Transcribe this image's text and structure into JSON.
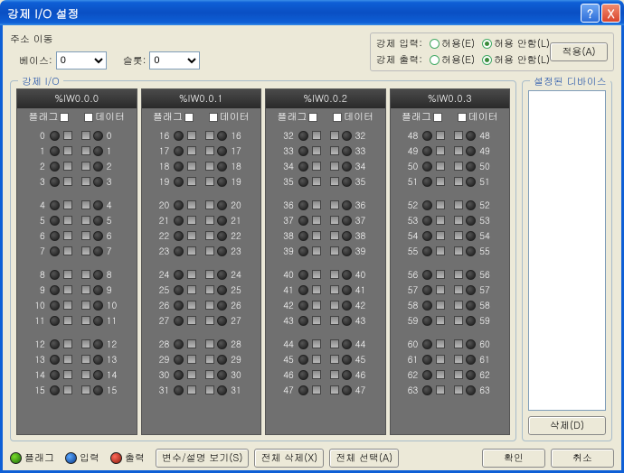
{
  "window": {
    "title": "강제 I/O 설정"
  },
  "addr": {
    "label": "주소 이동",
    "base_label": "베이스:",
    "base_value": "0",
    "slot_label": "슬롯:",
    "slot_value": "0"
  },
  "force": {
    "input_label": "강제 입력:",
    "output_label": "강제 출력:",
    "allow": "허용(E)",
    "disallow": "허용 안함(L)",
    "input_selected": "disallow",
    "output_selected": "disallow",
    "apply": "적용(A)"
  },
  "io_fieldset": "강제 I/O",
  "dev_fieldset": "설정된 디바이스",
  "columns": [
    {
      "header": "%IW0.0.0",
      "flag": "플래그",
      "data": "데이터",
      "start": 0
    },
    {
      "header": "%IW0.0.1",
      "flag": "플래그",
      "data": "데이터",
      "start": 16
    },
    {
      "header": "%IW0.0.2",
      "flag": "플래그",
      "data": "데이터",
      "start": 32
    },
    {
      "header": "%IW0.0.3",
      "flag": "플래그",
      "data": "데이터",
      "start": 48
    }
  ],
  "delete_btn": "삭제(D)",
  "legend": {
    "flag": "플래그",
    "input": "입력",
    "output": "출력"
  },
  "footer": {
    "vardesc": "변수/설명 보기(S)",
    "delall": "전체 삭제(X)",
    "selall": "전체 선택(A)",
    "ok": "확인",
    "cancel": "취소"
  },
  "chart_data": {
    "type": "table",
    "title": "강제 I/O 비트 상태",
    "columns": [
      "%IW0.0.0",
      "%IW0.0.1",
      "%IW0.0.2",
      "%IW0.0.3"
    ],
    "bits_per_column": 16,
    "ranges": [
      [
        0,
        15
      ],
      [
        16,
        31
      ],
      [
        32,
        47
      ],
      [
        48,
        63
      ]
    ],
    "flag_states": "all off",
    "data_states": "all off"
  }
}
